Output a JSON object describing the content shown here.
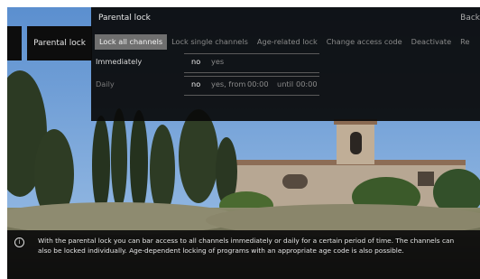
{
  "menu": {
    "tab_label": "Parental lock"
  },
  "panel": {
    "title": "Parental lock",
    "back_label": "Back",
    "tabs": [
      {
        "label": "Lock all channels",
        "active": true
      },
      {
        "label": "Lock single channels",
        "active": false
      },
      {
        "label": "Age-related lock",
        "active": false
      },
      {
        "label": "Change access code",
        "active": false
      },
      {
        "label": "Deactivate",
        "active": false
      },
      {
        "label": "Re",
        "active": false
      }
    ],
    "immediately": {
      "label": "Immediately",
      "no": "no",
      "yes": "yes"
    },
    "daily": {
      "label": "Daily",
      "no": "no",
      "yes_from": "yes, from",
      "from_time": "00:00",
      "until": "until",
      "until_time": "00:00"
    }
  },
  "info": {
    "icon": "info-icon",
    "text": "With the parental lock you can bar access to all channels immediately or daily for a certain period of time. The channels can also be locked individually. Age-dependent locking of programs with an appropriate age code is also possible."
  },
  "colors": {
    "panel_bg": "#0a0a0a",
    "active_tab": "#6f6f6f",
    "sky": "#6e9cd0"
  }
}
